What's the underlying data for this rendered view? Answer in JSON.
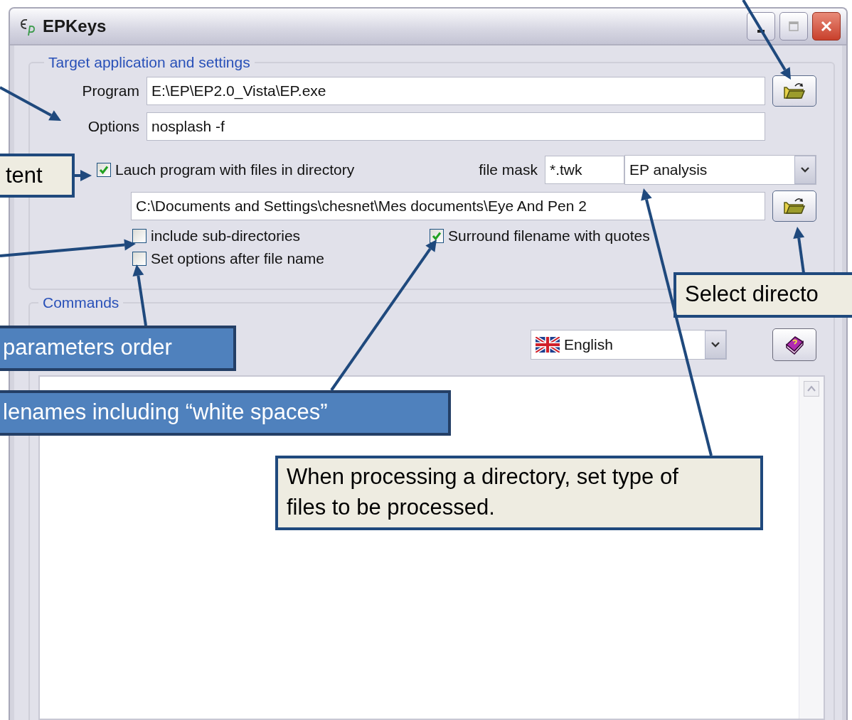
{
  "window": {
    "title": "EPKeys"
  },
  "target_group": {
    "legend": "Target application and settings",
    "program": {
      "label": "Program",
      "value": "E:\\EP\\EP2.0_Vista\\EP.exe"
    },
    "options": {
      "label": "Options",
      "value": "nosplash -f"
    },
    "launch_with_directory": {
      "label": "Lauch program with files in directory",
      "checked": true
    },
    "file_mask": {
      "label": "file mask",
      "value": "*.twk"
    },
    "file_type": {
      "value": "EP analysis"
    },
    "directory": {
      "value": "C:\\Documents and Settings\\chesnet\\Mes documents\\Eye And Pen 2"
    },
    "include_subdirectories": {
      "label": "include sub-directories",
      "checked": false
    },
    "surround_with_quotes": {
      "label": "Surround filename with quotes",
      "checked": true
    },
    "options_after_filename": {
      "label": "Set options after file name",
      "checked": false
    }
  },
  "commands_group": {
    "legend": "Commands",
    "language": {
      "value": "English"
    }
  },
  "callouts": [
    {
      "kind": "note",
      "text": "tent"
    },
    {
      "kind": "highlight",
      "text": "parameters order"
    },
    {
      "kind": "highlight",
      "text": "lenames including “white spaces”"
    },
    {
      "kind": "note",
      "text": "When processing a directory, set type of files to be processed."
    },
    {
      "kind": "note",
      "text": "Select directo"
    }
  ]
}
